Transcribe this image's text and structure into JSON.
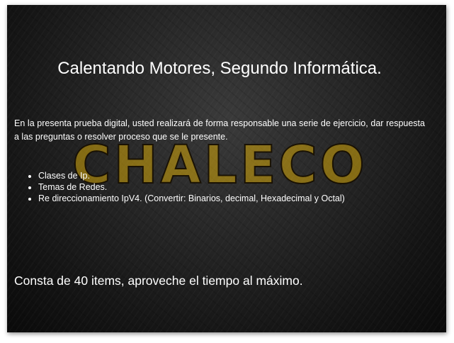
{
  "slide": {
    "watermark": "CHALECO",
    "title": "Calentando Motores, Segundo Informática.",
    "intro": "En la presenta prueba digital, usted realizará de forma responsable una serie de ejercicio, dar respuesta a las preguntas o resolver proceso que se le presente.",
    "topics": [
      "Clases de Ip.",
      "Temas de Redes.",
      "Re direccionamiento IpV4. (Convertir: Binarios, decimal, Hexadecimal y Octal)"
    ],
    "footer": "Consta de 40 items, aproveche el tiempo al máximo."
  },
  "colors": {
    "text": "#ffffff",
    "watermark": "#d6a80a",
    "background": "#1a1a1a"
  }
}
